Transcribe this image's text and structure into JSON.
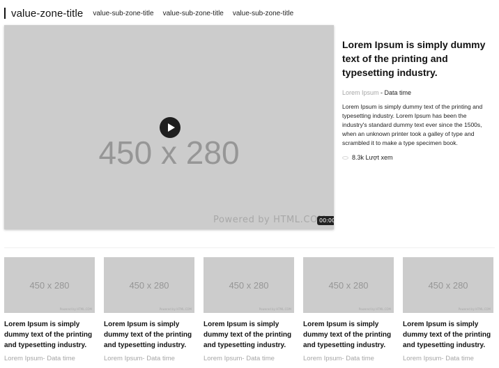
{
  "zone": {
    "title": "value-zone-title",
    "sub_titles": [
      "value-sub-zone-title",
      "value-sub-zone-title",
      "value-sub-zone-title"
    ]
  },
  "main_video": {
    "placeholder": "450 x 280",
    "powered_by": "Powered by HTML.COM",
    "duration": "00:00",
    "play_icon": "play-icon"
  },
  "main_article": {
    "title": "Lorem Ipsum is simply dummy text of the printing and typesetting industry.",
    "source": "Lorem Ipsum",
    "separator": " - ",
    "date": "Data time",
    "description": "Lorem Ipsum is simply dummy text of the printing and typesetting industry. Lorem Ipsum has been the industry's standard dummy text ever since the 1500s, when an unknown printer took a galley of type and scrambled it to make a type specimen book.",
    "views_icon": "eye-icon",
    "views": "8.3k Lượt xem"
  },
  "cards": [
    {
      "placeholder": "450 x 280",
      "powered_by": "Powered by HTML.COM",
      "title": "Lorem Ipsum is simply dummy text of the printing and typesetting industry.",
      "meta": "Lorem Ipsum- Data time"
    },
    {
      "placeholder": "450 x 280",
      "powered_by": "Powered by HTML.COM",
      "title": "Lorem Ipsum is simply dummy text of the printing and typesetting industry.",
      "meta": "Lorem Ipsum- Data time"
    },
    {
      "placeholder": "450 x 280",
      "powered_by": "Powered by HTML.COM",
      "title": "Lorem Ipsum is simply dummy text of the printing and typesetting industry.",
      "meta": "Lorem Ipsum- Data time"
    },
    {
      "placeholder": "450 x 280",
      "powered_by": "Powered by HTML.COM",
      "title": "Lorem Ipsum is simply dummy text of the printing and typesetting industry.",
      "meta": "Lorem Ipsum- Data time"
    },
    {
      "placeholder": "450 x 280",
      "powered_by": "Powered by HTML.COM",
      "title": "Lorem Ipsum is simply dummy text of the printing and typesetting industry.",
      "meta": "Lorem Ipsum- Data time"
    }
  ]
}
